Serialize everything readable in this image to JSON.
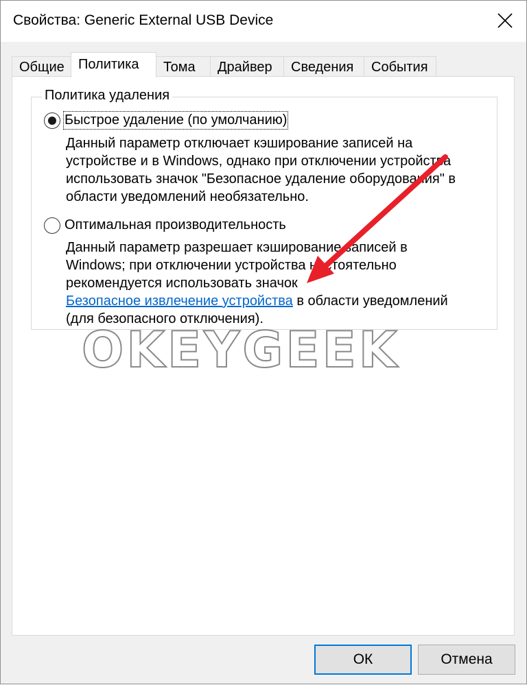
{
  "window": {
    "title": "Свойства: Generic External USB Device"
  },
  "tabs": [
    {
      "label": "Общие"
    },
    {
      "label": "Политика"
    },
    {
      "label": "Тома"
    },
    {
      "label": "Драйвер"
    },
    {
      "label": "Сведения"
    },
    {
      "label": "События"
    }
  ],
  "active_tab": "Политика",
  "removal_policy": {
    "group_label": "Политика удаления",
    "quick_removal": {
      "label": "Быстрое удаление (по умолчанию)",
      "selected": true,
      "description": [
        "Данный параметр отключает кэширование записей на",
        "устройстве и в Windows, однако при отключении устройства",
        "использовать значок \"Безопасное удаление оборудования\" в",
        "области уведомлений необязательно."
      ]
    },
    "better_performance": {
      "label": "Оптимальная производительность",
      "selected": false,
      "description": [
        "Данный параметр разрешает кэширование записей в",
        "Windows; при отключении устройства настоятельно",
        "рекомендуется использовать значок"
      ],
      "link_text": "Безопасное извлечение устройства",
      "after_link": " в области уведомлений",
      "last_line": "(для безопасного отключения)."
    }
  },
  "watermark": "OKEYGEEK",
  "annotation": {
    "color": "#e8202a"
  },
  "buttons": {
    "ok_label": "ОК",
    "cancel_label": "Отмена"
  },
  "colors": {
    "accent": "#0078d7",
    "link": "#0066cc"
  }
}
